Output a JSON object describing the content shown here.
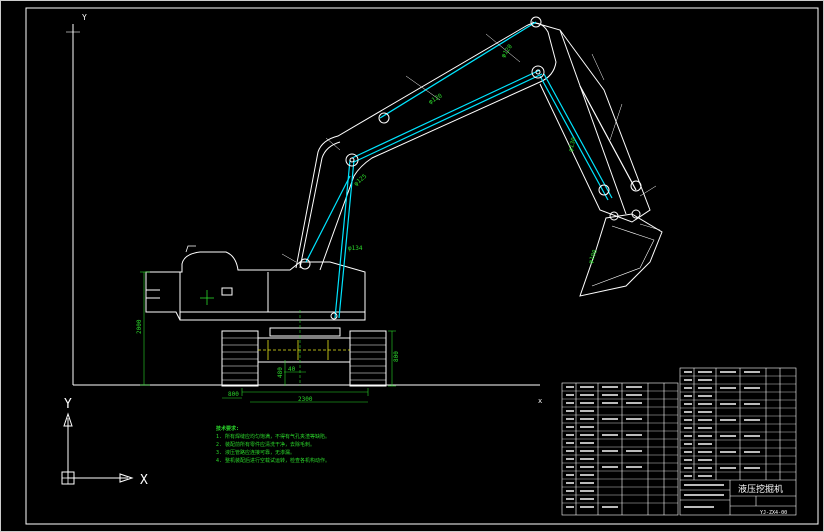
{
  "drawing": {
    "axis_top": {
      "y_label": "Y",
      "x_label": "x"
    },
    "ucs_icon": {
      "y_label": "Y",
      "x_label": "X"
    },
    "dimensions": {
      "height_left": "2000",
      "track_height": "800",
      "ground_clearance": "480",
      "center_offset": "40",
      "track_width": "2300",
      "overhang": "800"
    },
    "boom_labels": [
      "φ120",
      "φ120",
      "φ130",
      "φ125",
      "φ134",
      "φ100"
    ],
    "title_block": {
      "main_title": "液压挖掘机",
      "drawing_no": "YJ-ZX4-00"
    },
    "notes": {
      "title": "技术要求:",
      "items": [
        "1. 所有焊缝应均匀饱满，不得有气孔夹渣等缺陷。",
        "2. 装配前所有零件应清洗干净，去除毛刺。",
        "3. 液压管路应连接可靠，无渗漏。",
        "4. 整机装配后进行空载试运转，检查各机构动作。"
      ]
    },
    "colors": {
      "line": "#ffffff",
      "hydraulic": "#00e5ff",
      "dimension": "#2bd82b",
      "text": "#ffffff"
    }
  }
}
